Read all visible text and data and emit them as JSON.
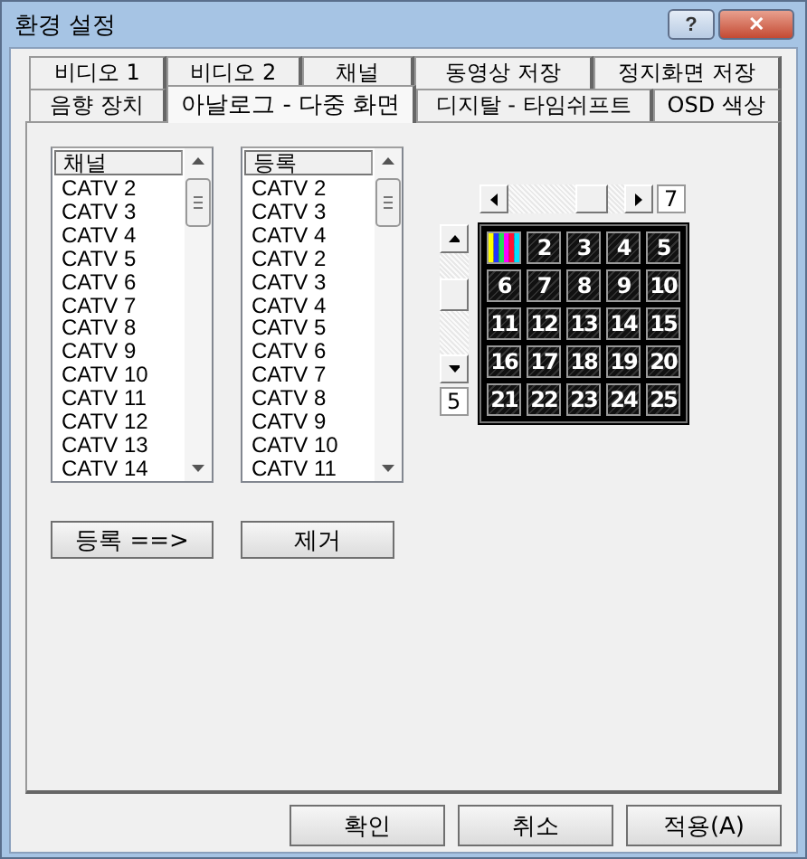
{
  "window": {
    "title": "환경 설정",
    "buttons": [
      {
        "kind": "help",
        "label": "?"
      },
      {
        "kind": "close",
        "label": "✕"
      }
    ]
  },
  "tab_rows": [
    {
      "tabs": [
        {
          "label": "비디오 1",
          "selected": false
        },
        {
          "label": "비디오 2",
          "selected": false
        },
        {
          "label": "채널",
          "selected": false
        },
        {
          "label": "동영상 저장",
          "selected": false
        },
        {
          "label": "정지화면 저장",
          "selected": false
        }
      ]
    },
    {
      "tabs": [
        {
          "label": "음향 장치",
          "selected": false
        },
        {
          "label": "아날로그 - 다중 화면",
          "selected": true
        },
        {
          "label": "디지탈 - 타임쉬프트",
          "selected": false
        },
        {
          "label": "OSD 색상",
          "selected": false
        }
      ]
    }
  ],
  "lists": [
    {
      "header": "채널",
      "items": [
        "CATV 2",
        "CATV 3",
        "CATV 4",
        "CATV 5",
        "CATV 6",
        "CATV 7",
        "CATV 8",
        "CATV 9",
        "CATV 10",
        "CATV 11",
        "CATV 12",
        "CATV 13",
        "CATV 14"
      ]
    },
    {
      "header": "등록",
      "items": [
        "CATV 2",
        "CATV 3",
        "CATV 4",
        "CATV 2",
        "CATV 3",
        "CATV 4",
        "CATV 5",
        "CATV 6",
        "CATV 7",
        "CATV 8",
        "CATV 9",
        "CATV 10",
        "CATV 11"
      ]
    }
  ],
  "list_buttons": [
    "등록 ==>",
    "제거"
  ],
  "horizontal_slider": {
    "level": 0.8,
    "reading": "7"
  },
  "vertical_slider": {
    "reading": "5"
  },
  "screen_grid": [
    {
      "kind": "color-bars"
    },
    {
      "kind": "number",
      "label": "2"
    },
    {
      "kind": "number",
      "label": "3"
    },
    {
      "kind": "number",
      "label": "4"
    },
    {
      "kind": "number",
      "label": "5"
    },
    {
      "kind": "number",
      "label": "6"
    },
    {
      "kind": "number",
      "label": "7"
    },
    {
      "kind": "number",
      "label": "8"
    },
    {
      "kind": "number",
      "label": "9"
    },
    {
      "kind": "number",
      "label": "10"
    },
    {
      "kind": "number",
      "label": "11"
    },
    {
      "kind": "number",
      "label": "12"
    },
    {
      "kind": "number",
      "label": "13"
    },
    {
      "kind": "number",
      "label": "14"
    },
    {
      "kind": "number",
      "label": "15"
    },
    {
      "kind": "number",
      "label": "16"
    },
    {
      "kind": "number",
      "label": "17"
    },
    {
      "kind": "number",
      "label": "18"
    },
    {
      "kind": "number",
      "label": "19"
    },
    {
      "kind": "number",
      "label": "20"
    },
    {
      "kind": "number",
      "label": "21"
    },
    {
      "kind": "number",
      "label": "22"
    },
    {
      "kind": "number",
      "label": "23"
    },
    {
      "kind": "number",
      "label": "24"
    },
    {
      "kind": "number",
      "label": "25"
    }
  ],
  "dialog_buttons": [
    "확인",
    "취소",
    "적용(A)"
  ]
}
